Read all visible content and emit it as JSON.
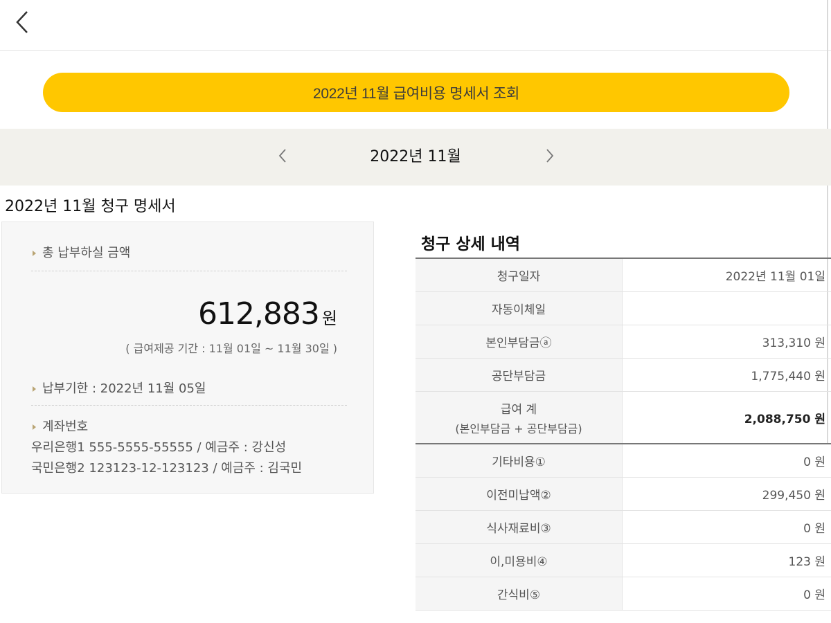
{
  "header": {
    "back_icon": "chevron-left-icon"
  },
  "query_button": {
    "label": "2022년 11월 급여비용 명세서 조회",
    "color": "#ffc700"
  },
  "month_nav": {
    "label": "2022년 11월"
  },
  "statement": {
    "title": "2022년 11월 청구 명세서",
    "total_label": "총 납부하실 금액",
    "total_amount": "612,883",
    "currency": "원",
    "period": "( 급여제공 기간 : 11월 01일 ~ 11월 30일 )",
    "due_date": "납부기한 : 2022년 11월 05일",
    "account_label": "계좌번호",
    "accounts": [
      "우리은행1 555-5555-55555 / 예금주 : 강신성",
      "국민은행2 123123-12-123123 / 예금주 : 김국민"
    ]
  },
  "details": {
    "title": "청구 상세 내역",
    "rows": [
      {
        "label": "청구일자",
        "value": "2022년 11월 01일"
      },
      {
        "label": "자동이체일",
        "value": ""
      },
      {
        "label": "본인부담금ⓐ",
        "value": "313,310 원"
      },
      {
        "label": "공단부담금",
        "value": "1,775,440 원"
      },
      {
        "label": "급여 계",
        "sub": "(본인부담금 + 공단부담금)",
        "value": "2,088,750 원"
      },
      {
        "label": "기타비용①",
        "value": "0 원"
      },
      {
        "label": "이전미납액②",
        "value": "299,450 원"
      },
      {
        "label": "식사재료비③",
        "value": "0 원"
      },
      {
        "label": "이,미용비④",
        "value": "123 원"
      },
      {
        "label": "간식비⑤",
        "value": "0 원"
      }
    ]
  }
}
